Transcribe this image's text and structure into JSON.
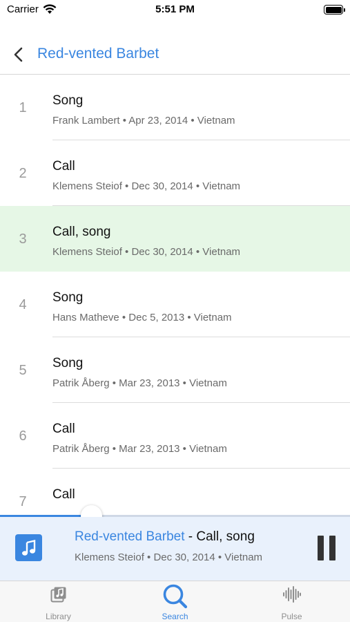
{
  "status_bar": {
    "carrier": "Carrier",
    "time": "5:51 PM"
  },
  "nav": {
    "title": "Red-vented Barbet"
  },
  "recordings": [
    {
      "index": "1",
      "type": "Song",
      "details": "Frank Lambert • Apr 23, 2014 • Vietnam",
      "selected": false
    },
    {
      "index": "2",
      "type": "Call",
      "details": "Klemens Steiof • Dec 30, 2014 • Vietnam",
      "selected": false
    },
    {
      "index": "3",
      "type": "Call, song",
      "details": "Klemens Steiof • Dec 30, 2014 • Vietnam",
      "selected": true
    },
    {
      "index": "4",
      "type": "Song",
      "details": "Hans Matheve • Dec 5, 2013 • Vietnam",
      "selected": false
    },
    {
      "index": "5",
      "type": "Song",
      "details": "Patrik Åberg • Mar 23, 2013 • Vietnam",
      "selected": false
    },
    {
      "index": "6",
      "type": "Call",
      "details": "Patrik Åberg • Mar 23, 2013 • Vietnam",
      "selected": false
    },
    {
      "index": "7",
      "type": "Call",
      "details": "",
      "selected": false
    }
  ],
  "player": {
    "species": "Red-vented Barbet",
    "separator": " - ",
    "type": "Call, song",
    "details": "Klemens Steiof • Dec 30, 2014 • Vietnam",
    "progress": 0.26
  },
  "tabs": [
    {
      "label": "Library",
      "icon": "library-icon",
      "active": false
    },
    {
      "label": "Search",
      "icon": "search-icon",
      "active": true
    },
    {
      "label": "Pulse",
      "icon": "waveform-icon",
      "active": false
    }
  ],
  "colors": {
    "accent": "#3a86e0",
    "selected_row": "#e6f7e6",
    "player_bg": "#e9f1fc"
  }
}
